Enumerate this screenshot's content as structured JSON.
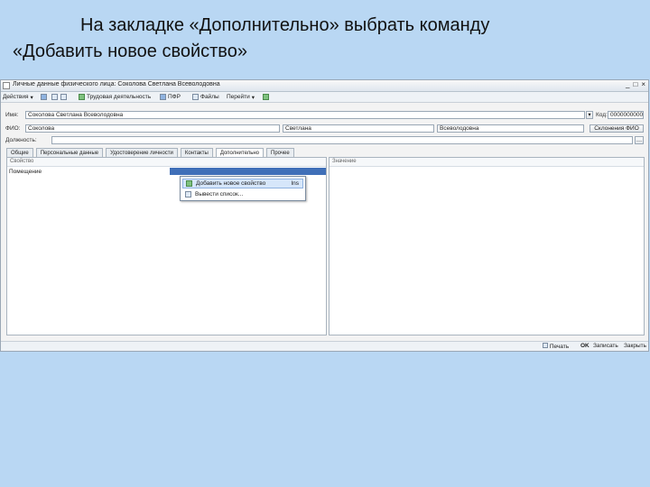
{
  "slide": {
    "title_line1": "На закладке «Дополнительно» выбрать команду",
    "title_line2": "«Добавить новое свойство»"
  },
  "window": {
    "title": "Личные данные физического лица: Соколова Светлана Всеволодовна",
    "controls": [
      "_",
      "□",
      "×"
    ]
  },
  "toolbar": {
    "actions": "Действия",
    "work_activity": "Трудовая деятельность",
    "pfr": "ПФР",
    "files": "Файлы",
    "goto": "Перейти"
  },
  "form": {
    "name_label": "Имя:",
    "name_value": "Соколова Светлана Всеволодовна",
    "code_value": "0000000000",
    "fio_label": "ФИО:",
    "last_name": "Соколова",
    "first_name": "Светлана",
    "middle_name": "Всеволодовна",
    "fio_button": "Склонения ФИО",
    "position_label": "Должность:",
    "position_value": ""
  },
  "tabs": [
    {
      "label": "Общие"
    },
    {
      "label": "Персональные данные"
    },
    {
      "label": "Удостоверение личности"
    },
    {
      "label": "Контакты"
    },
    {
      "label": "Дополнительно"
    },
    {
      "label": "Прочее"
    }
  ],
  "properties_panel": {
    "header": "Свойство",
    "rows": [
      "Помещение"
    ]
  },
  "values_panel": {
    "header": "Значение"
  },
  "context_menu": {
    "items": [
      {
        "label": "Добавить новое свойство",
        "shortcut": "Ins"
      },
      {
        "label": "Вывести список..."
      }
    ]
  },
  "statusbar": {
    "print": "Печать",
    "ok": "OK",
    "save": "Записать",
    "close": "Закрыть"
  }
}
